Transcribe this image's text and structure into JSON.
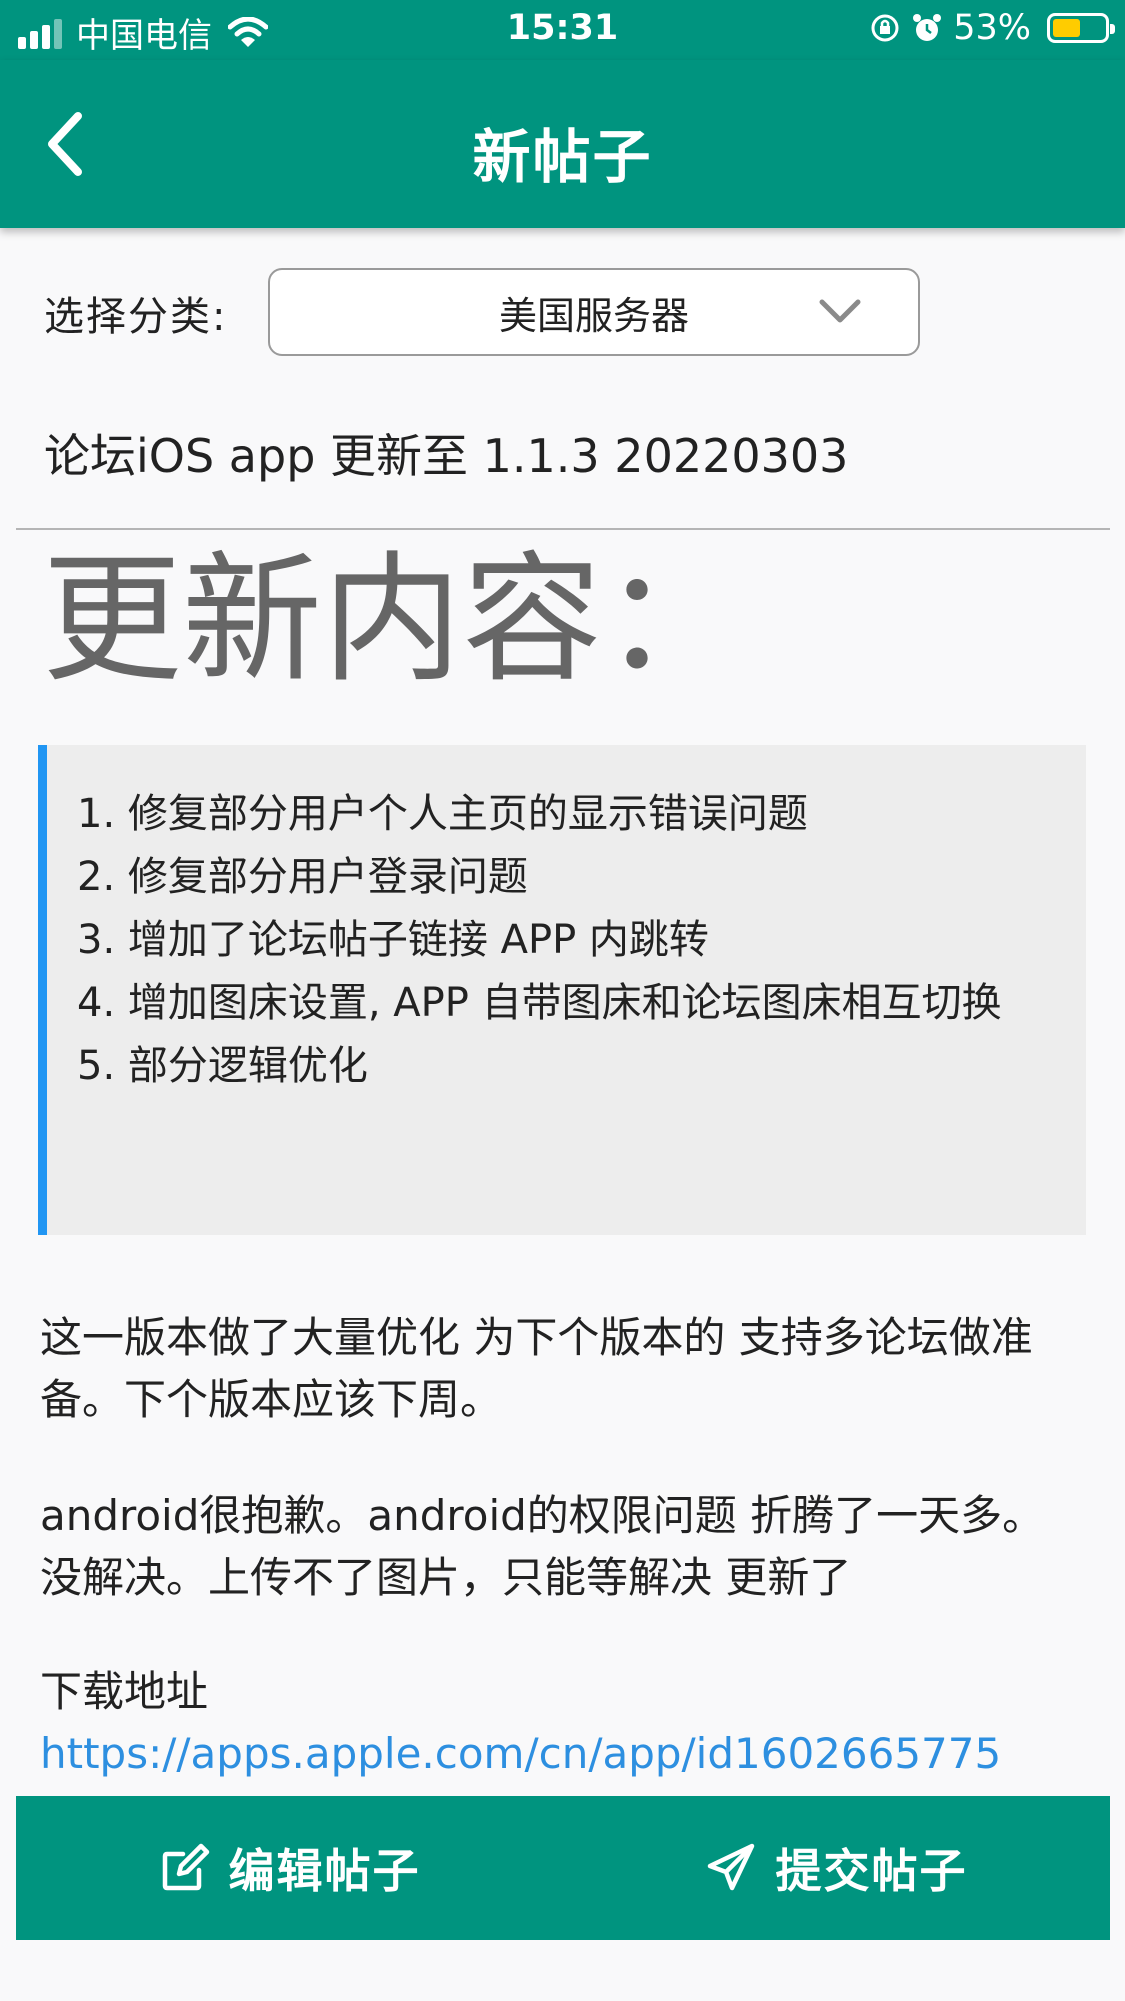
{
  "status_bar": {
    "carrier": "中国电信",
    "time": "15:31",
    "battery_percent": "53%",
    "battery_level": 0.53,
    "battery_color": "#ffcc00"
  },
  "nav": {
    "title": "新帖子"
  },
  "category": {
    "label": "选择分类:",
    "selected": "美国服务器"
  },
  "post": {
    "title": "论坛iOS  app 更新至 1.1.3  20220303",
    "heading": "更新内容：",
    "changelog": [
      "1. 修复部分用户个人主页的显示错误问题",
      "2. 修复部分用户登录问题",
      "3. 增加了论坛帖子链接 APP 内跳转",
      "4. 增加图床设置, APP 自带图床和论坛图床相互切换",
      "5. 部分逻辑优化"
    ],
    "paragraph1": "这一版本做了大量优化 为下个版本的 支持多论坛做准备。下个版本应该下周。",
    "paragraph2": "android很抱歉。android的权限问题 折腾了一天多。没解决。上传不了图片，只能等解决 更新了",
    "download_label": "下载地址",
    "download_link": "https://apps.apple.com/cn/app/id1602665775"
  },
  "actions": {
    "edit_label": "编辑帖子",
    "submit_label": "提交帖子"
  },
  "colors": {
    "primary": "#00947f",
    "quote_border": "#2196f3",
    "link": "#2d8fe0"
  }
}
